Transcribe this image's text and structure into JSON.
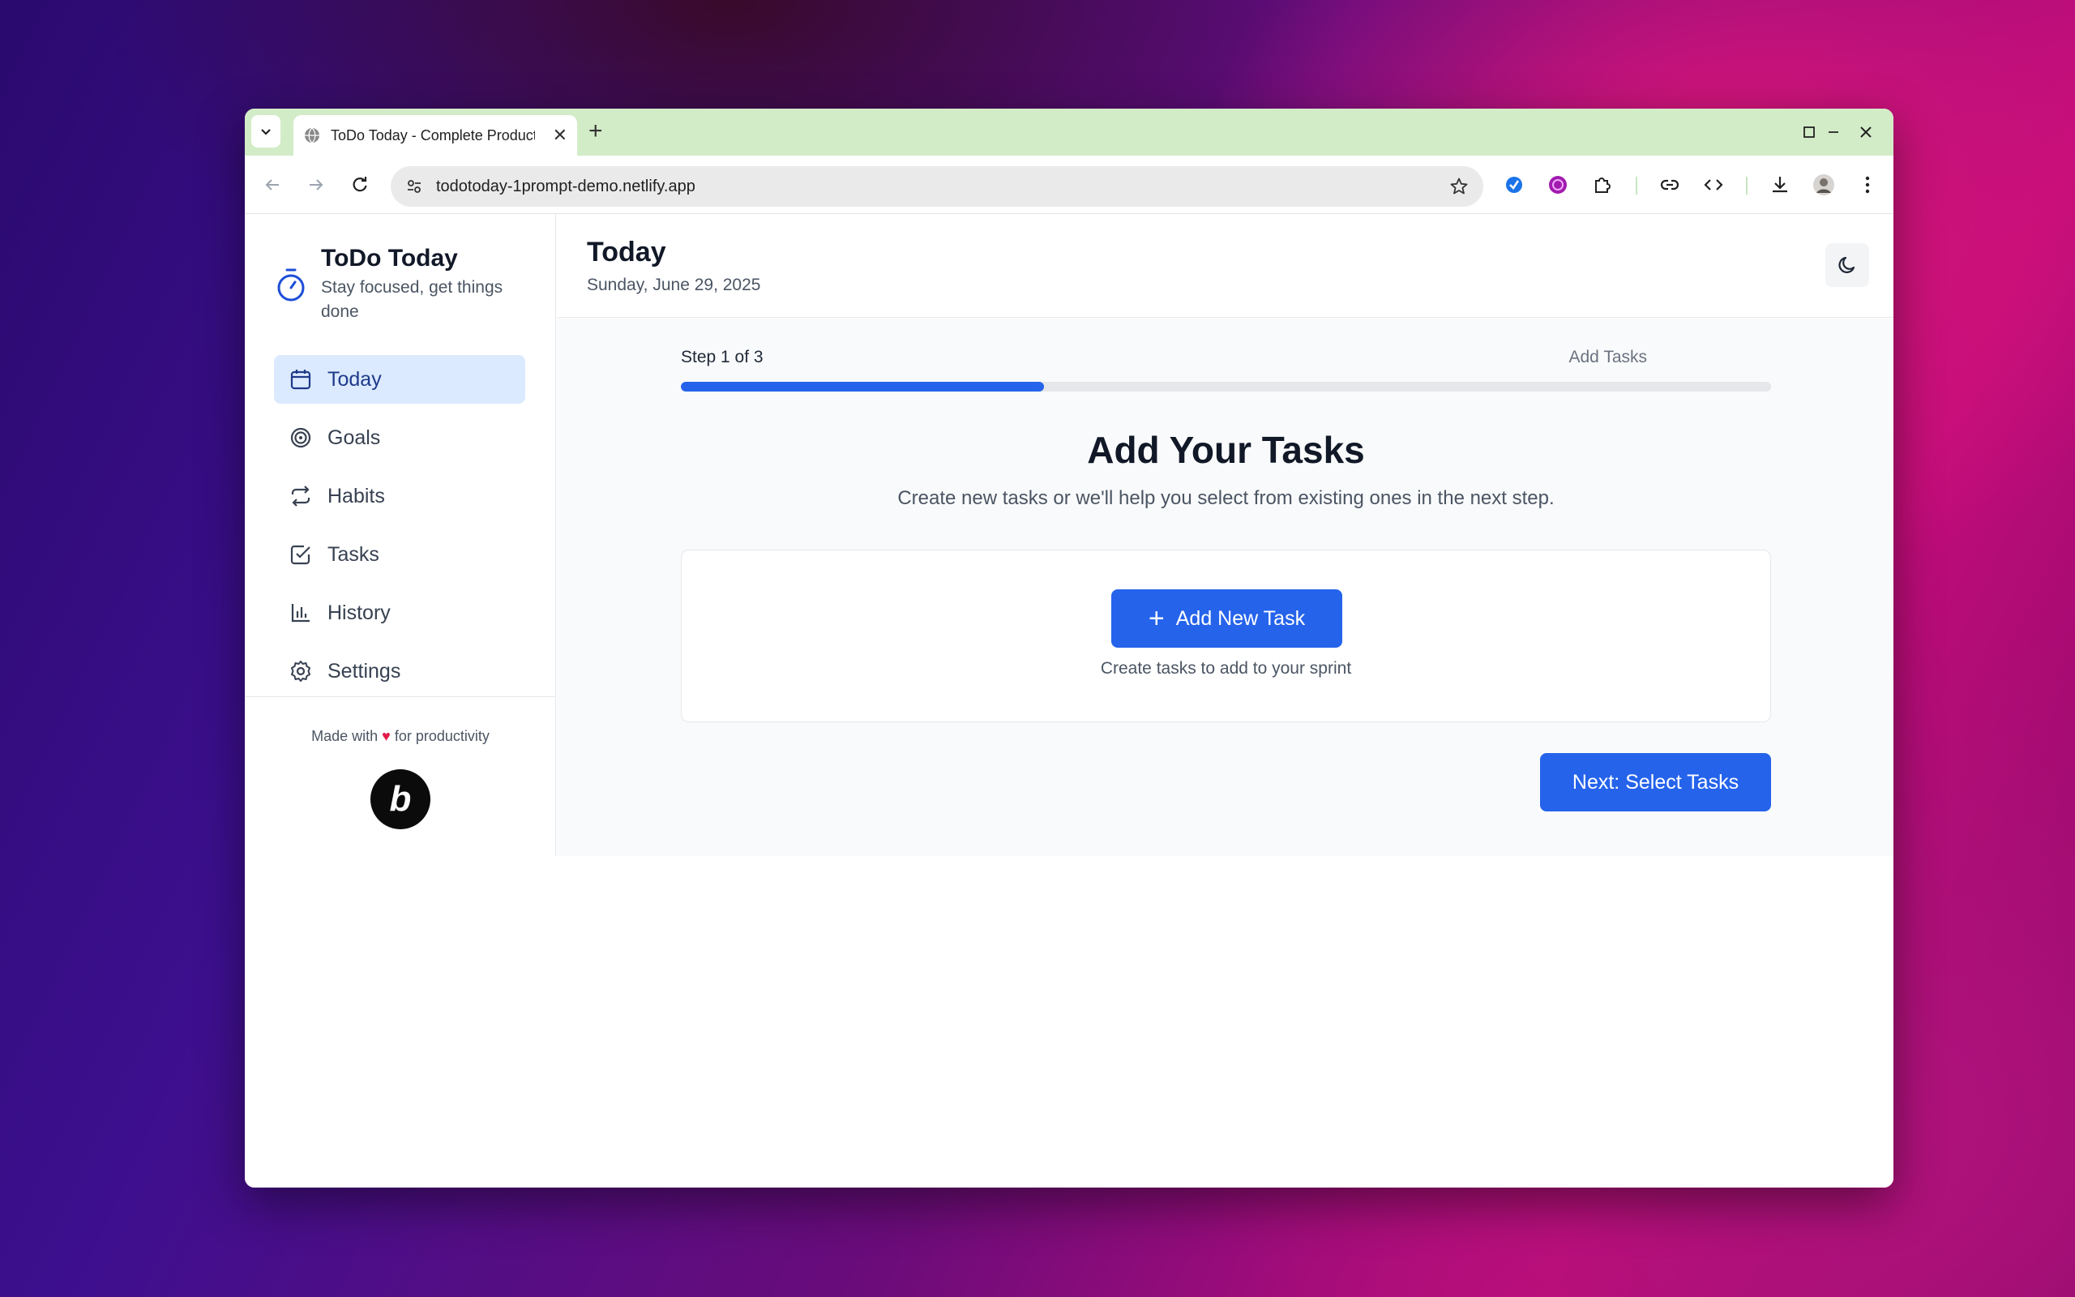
{
  "browser": {
    "tab_title": "ToDo Today - Complete Productivity",
    "url": "todotoday-1prompt-demo.netlify.app"
  },
  "sidebar": {
    "app_name": "ToDo Today",
    "tagline": "Stay focused, get things done",
    "items": [
      {
        "label": "Today",
        "icon": "calendar-icon",
        "active": true
      },
      {
        "label": "Goals",
        "icon": "target-icon",
        "active": false
      },
      {
        "label": "Habits",
        "icon": "repeat-icon",
        "active": false
      },
      {
        "label": "Tasks",
        "icon": "check-square-icon",
        "active": false
      },
      {
        "label": "History",
        "icon": "bar-chart-icon",
        "active": false
      },
      {
        "label": "Settings",
        "icon": "gear-icon",
        "active": false
      }
    ],
    "footer_prefix": "Made with",
    "footer_heart": "♥",
    "footer_suffix": "for productivity",
    "badge_letter": "b"
  },
  "header": {
    "title": "Today",
    "date": "Sunday, June 29, 2025"
  },
  "wizard": {
    "step_label": "Step 1 of 3",
    "step_name": "Add Tasks",
    "progress_fraction": 0.333,
    "heading": "Add Your Tasks",
    "subheading": "Create new tasks or we'll help you select from existing ones in the next step.",
    "add_button": "Add New Task",
    "card_hint": "Create tasks to add to your sprint",
    "next_button": "Next: Select Tasks"
  },
  "colors": {
    "accent": "#2563eb",
    "active_nav_bg": "#dbeafe",
    "tabstrip": "#d3ecc8"
  }
}
